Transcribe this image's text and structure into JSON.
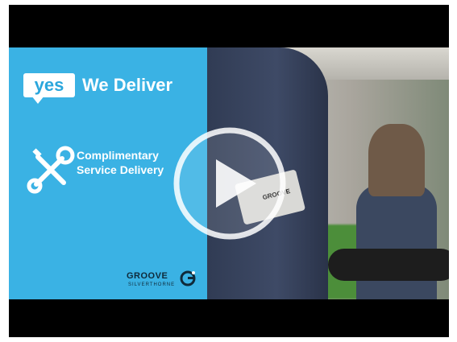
{
  "slide": {
    "badge_text": "yes",
    "headline": "We Deliver",
    "service_line1": "Complimentary",
    "service_line2": "Service Delivery",
    "logo_brand": "GROOVE",
    "logo_location": "SILVERTHORNE"
  },
  "patch": {
    "brand": "GROOVE"
  },
  "colors": {
    "accent_blue": "#3ab2e4",
    "letterbox": "#000000",
    "play_overlay": "#ffffff"
  },
  "icons": {
    "tools": "wrench-screwdriver-icon",
    "play": "play-icon",
    "logo": "groove-logo-icon"
  }
}
